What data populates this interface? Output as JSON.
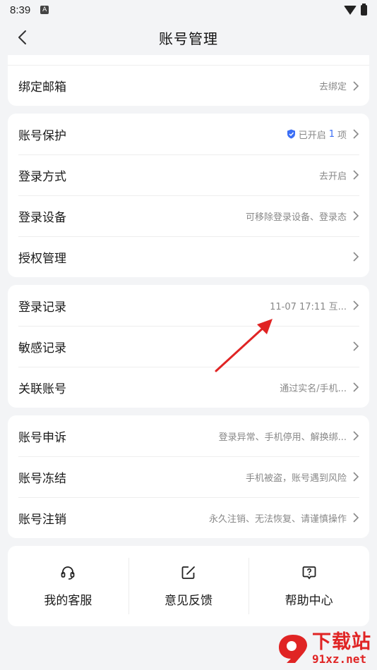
{
  "status_bar": {
    "time": "8:39",
    "app_badge": "A"
  },
  "nav": {
    "title": "账号管理"
  },
  "sections": [
    {
      "rows": [
        {
          "label": "绑定邮箱",
          "value": "去绑定"
        }
      ]
    },
    {
      "rows": [
        {
          "label": "账号保护",
          "value_prefix": "已开启",
          "value_count": "1",
          "value_suffix": "项"
        },
        {
          "label": "登录方式",
          "value": "去开启"
        },
        {
          "label": "登录设备",
          "value": "可移除登录设备、登录态"
        },
        {
          "label": "授权管理",
          "value": ""
        }
      ]
    },
    {
      "rows": [
        {
          "label": "登录记录",
          "value": "11-07 17:11 互..."
        },
        {
          "label": "敏感记录",
          "value": ""
        },
        {
          "label": "关联账号",
          "value": "通过实名/手机..."
        }
      ]
    },
    {
      "rows": [
        {
          "label": "账号申诉",
          "value": "登录异常、手机停用、解换绑..."
        },
        {
          "label": "账号冻结",
          "value": "手机被盗，账号遇到风险"
        },
        {
          "label": "账号注销",
          "value": "永久注销、无法恢复、请谨慎操作"
        }
      ]
    }
  ],
  "bottom_actions": [
    {
      "label": "我的客服",
      "icon": "headset-icon"
    },
    {
      "label": "意见反馈",
      "icon": "edit-icon"
    },
    {
      "label": "帮助中心",
      "icon": "help-icon"
    }
  ],
  "watermark": {
    "text": "下载站",
    "url": "91xz.net"
  },
  "colors": {
    "accent": "#3b6ef5",
    "annotation": "#e02424",
    "background": "#f3f4f6"
  }
}
